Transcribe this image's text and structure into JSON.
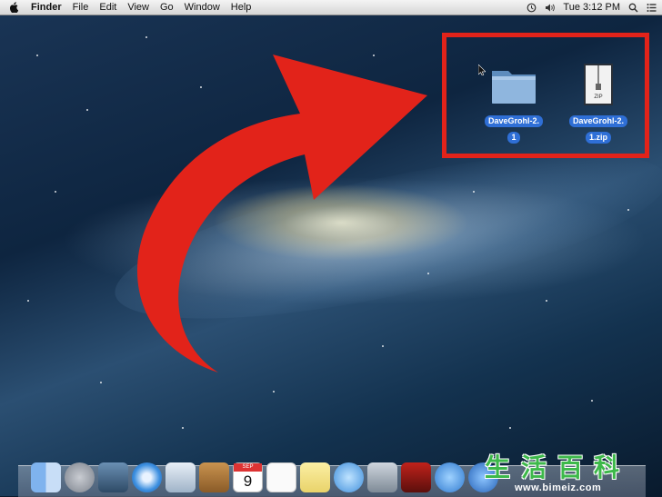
{
  "menubar": {
    "app_name": "Finder",
    "items": [
      "File",
      "Edit",
      "View",
      "Go",
      "Window",
      "Help"
    ],
    "clock": "Tue 3:12 PM",
    "icons": [
      "apple-icon",
      "time-machine-icon",
      "volume-icon",
      "spotlight-icon",
      "notifications-icon"
    ]
  },
  "desktop": {
    "items": [
      {
        "label_line1": "DaveGrohl-2.",
        "label_line2": "1",
        "icon": "folder-icon"
      },
      {
        "label_line1": "DaveGrohl-2.",
        "label_line2": "1.zip",
        "icon": "zip-file-icon",
        "badge": "ZIP"
      }
    ],
    "highlight_color": "#e2231a",
    "arrow_color": "#e2231a"
  },
  "dock": {
    "icons": [
      "finder-icon",
      "launchpad-icon",
      "mission-control-icon",
      "safari-icon",
      "mail-icon",
      "contacts-icon",
      "calendar-icon",
      "reminders-icon",
      "notes-icon",
      "messages-icon",
      "facetime-icon",
      "photo-booth-icon",
      "itunes-icon",
      "app-store-icon"
    ],
    "calendar": {
      "month": "SEP",
      "day": "9"
    }
  },
  "watermark": {
    "chars": [
      "生",
      "活",
      "百",
      "科"
    ],
    "url": "www.bimeiz.com"
  }
}
